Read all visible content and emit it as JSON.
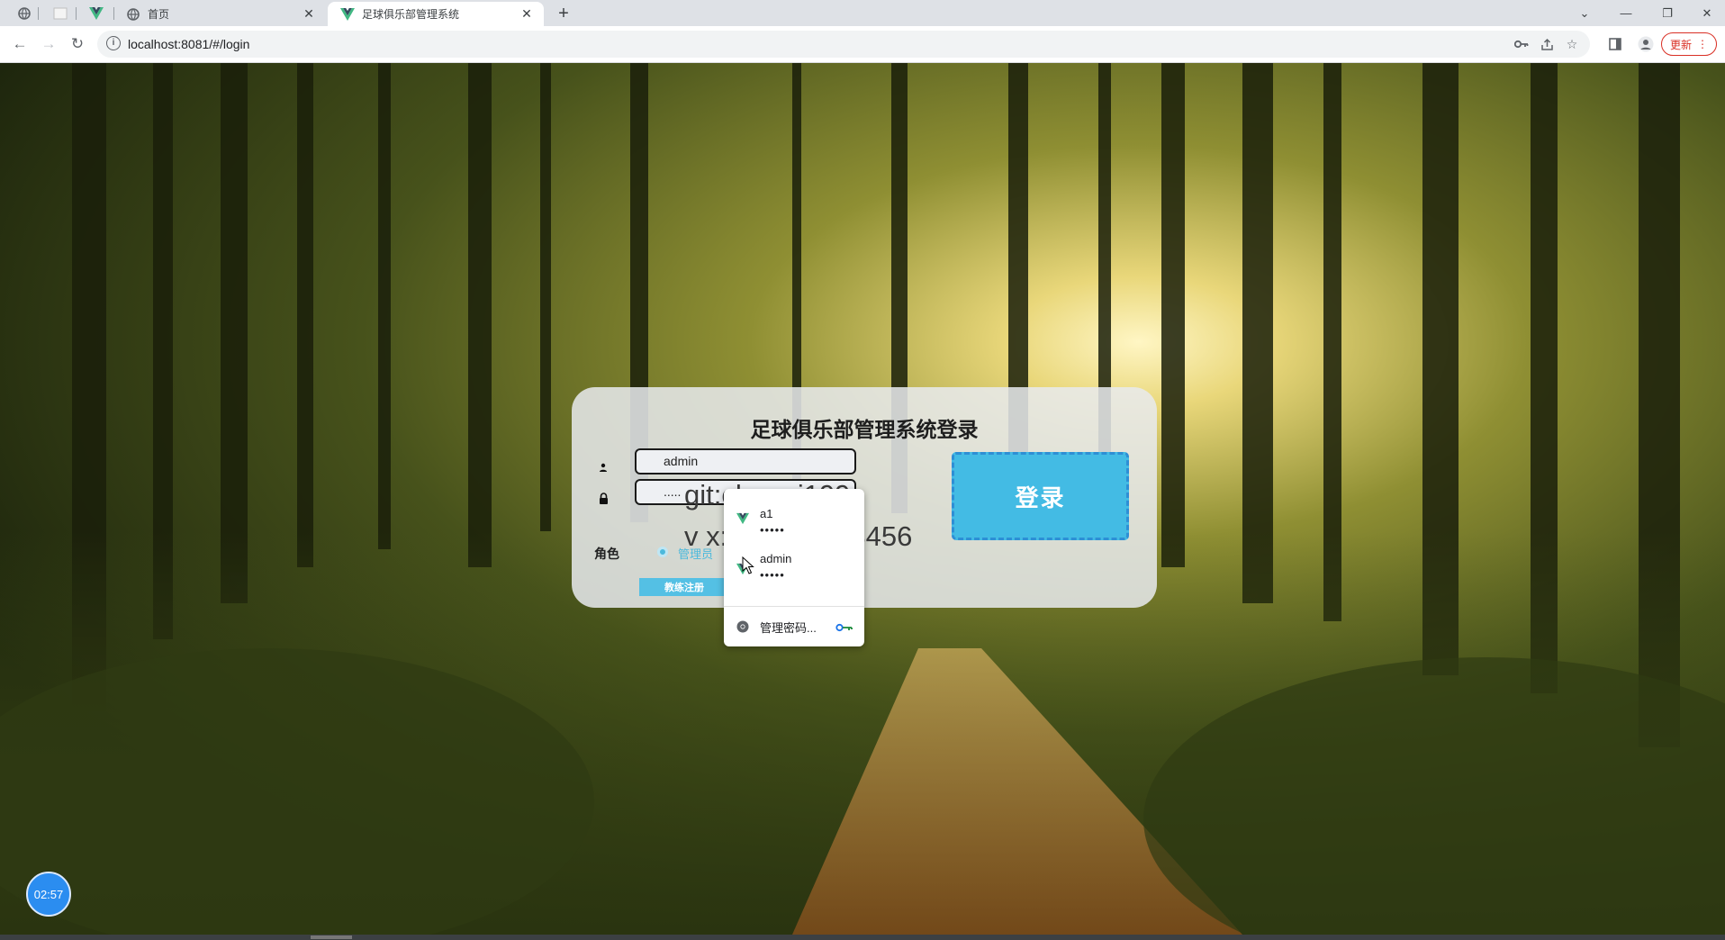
{
  "browser": {
    "tabs": [
      {
        "title": "首页",
        "active": false
      },
      {
        "title": "足球俱乐部管理系统",
        "active": true
      }
    ],
    "url": "localhost:8081/#/login",
    "update_label": "更新"
  },
  "login": {
    "title": "足球俱乐部管理系统登录",
    "username_value": "admin",
    "password_value": ".....",
    "role_label": "角色",
    "role_option": "管理员",
    "register_label": "教练注册",
    "login_label": "登录"
  },
  "autofill": {
    "entries": [
      {
        "username": "a1",
        "password": "•••••"
      },
      {
        "username": "admin",
        "password": "•••••"
      }
    ],
    "manage_label": "管理密码..."
  },
  "watermark": {
    "line1": "git:chenqi199",
    "line2": "v x:chen_q123456"
  },
  "clock": {
    "time": "02:57"
  },
  "colors": {
    "accent": "#43bbe4",
    "register": "#54c0e4",
    "clock": "#2b8df0"
  }
}
